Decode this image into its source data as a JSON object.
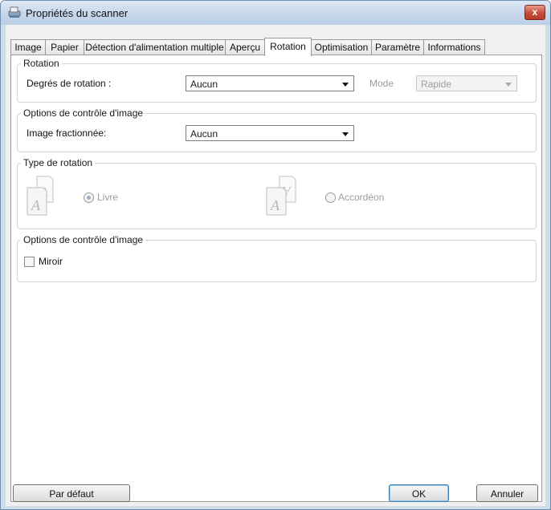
{
  "window": {
    "title": "Propriétés du scanner",
    "close_label": "x",
    "icon": "scanner-icon"
  },
  "tabs": [
    {
      "label": "Image"
    },
    {
      "label": "Papier"
    },
    {
      "label": "Détection d'alimentation multiple"
    },
    {
      "label": "Aperçu"
    },
    {
      "label": "Rotation",
      "active": true
    },
    {
      "label": "Optimisation"
    },
    {
      "label": "Paramètre"
    },
    {
      "label": "Informations"
    }
  ],
  "rotation": {
    "group_label": "Rotation",
    "degrees_label": "Degrés de rotation :",
    "degrees_value": "Aucun",
    "mode_label": "Mode",
    "mode_value": "Rapide"
  },
  "image_control": {
    "group_label": "Options de contrôle d'image",
    "split_label": "Image fractionnée:",
    "split_value": "Aucun"
  },
  "rotation_type": {
    "group_label": "Type de rotation",
    "book_label": "Livre",
    "book_selected": true,
    "fan_label": "Accordéon",
    "fan_selected": false
  },
  "image_control_2": {
    "group_label": "Options de contrôle d'image",
    "mirror_label": "Miroir",
    "mirror_checked": false
  },
  "buttons": {
    "default_label": "Par défaut",
    "ok_label": "OK",
    "cancel_label": "Annuler"
  },
  "colors": {
    "titlebar": "#c5d6ea",
    "close": "#c64a38",
    "default_button_border": "#3c7fb1"
  }
}
